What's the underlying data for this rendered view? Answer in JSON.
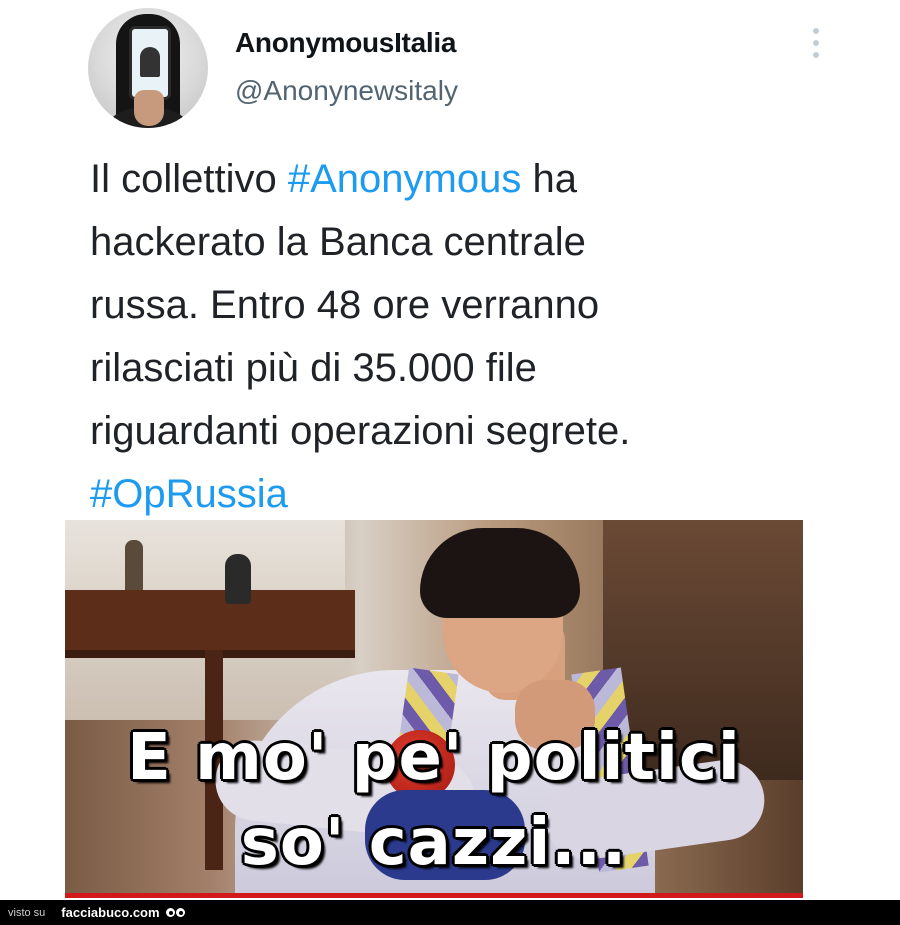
{
  "author": {
    "display_name": "AnonymousItalia",
    "handle": "@Anonynewsitaly"
  },
  "tweet": {
    "lines": [
      [
        {
          "text": "Il collettivo ",
          "hashtag": false
        },
        {
          "text": "#Anonymous",
          "hashtag": true
        },
        {
          "text": " ha",
          "hashtag": false
        }
      ],
      [
        {
          "text": "hackerato la Banca centrale",
          "hashtag": false
        }
      ],
      [
        {
          "text": "russa.  Entro 48 ore verranno",
          "hashtag": false
        }
      ],
      [
        {
          "text": "rilasciati più di 35.000 file",
          "hashtag": false
        }
      ],
      [
        {
          "text": "riguardanti operazioni segrete.",
          "hashtag": false
        }
      ],
      [
        {
          "text": "#OpRussia",
          "hashtag": true
        }
      ]
    ]
  },
  "meme": {
    "caption_line1": "E mo' pe' politici",
    "caption_line2": "so' cazzi..."
  },
  "watermark": {
    "prefix": "visto su",
    "site": "facciabuco.com"
  },
  "icons": {
    "more": "more-vertical-icon",
    "logo": "eyes-logo-icon"
  },
  "colors": {
    "hashtag": "#1d9bf0",
    "handle": "#536471",
    "text": "#1f2328"
  }
}
